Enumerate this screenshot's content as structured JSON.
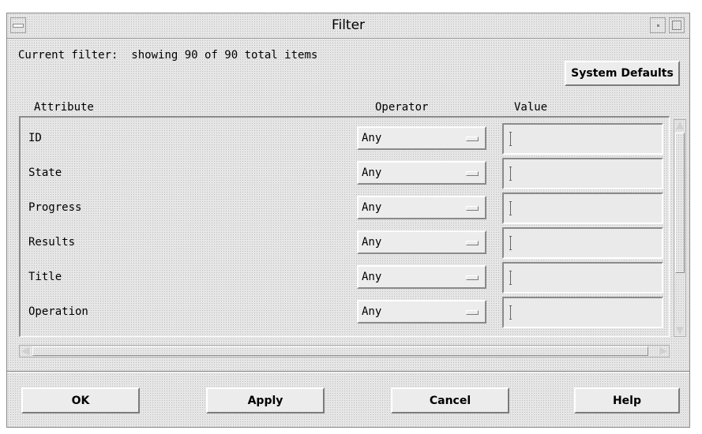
{
  "window": {
    "title": "Filter",
    "icons": {
      "menu": "window-menu-icon",
      "minimize": "minimize-icon",
      "maximize": "maximize-icon"
    }
  },
  "status": {
    "label": "Current filter:",
    "text": "showing 90 of 90 total items"
  },
  "system_defaults_label": "System Defaults",
  "headers": {
    "attribute": "Attribute",
    "operator": "Operator",
    "value": "Value"
  },
  "rows": [
    {
      "attribute": "ID",
      "operator": "Any",
      "value": ""
    },
    {
      "attribute": "State",
      "operator": "Any",
      "value": ""
    },
    {
      "attribute": "Progress",
      "operator": "Any",
      "value": ""
    },
    {
      "attribute": "Results",
      "operator": "Any",
      "value": ""
    },
    {
      "attribute": "Title",
      "operator": "Any",
      "value": ""
    },
    {
      "attribute": "Operation",
      "operator": "Any",
      "value": ""
    }
  ],
  "buttons": {
    "ok": "OK",
    "apply": "Apply",
    "cancel": "Cancel",
    "help": "Help"
  }
}
